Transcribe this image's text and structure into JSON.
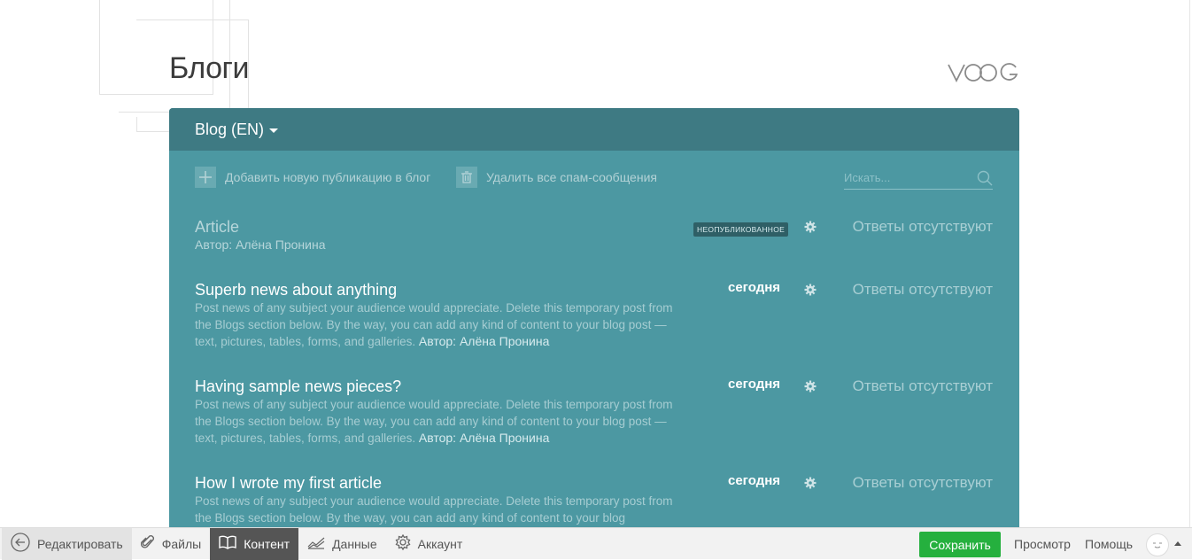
{
  "page": {
    "title": "Блоги",
    "logo_text": "VOOG"
  },
  "panel": {
    "blog_selector": "Blog (EN)",
    "toolbar": {
      "add_post": "Добавить новую публикацию в блог",
      "delete_spam": "Удалить все спам-сообщения",
      "search_placeholder": "Искать..."
    },
    "posts": [
      {
        "title": "Article",
        "author_line": "Автор: Алёна Пронина",
        "badge": "НЕОПУБЛИКОВАННОЕ",
        "replies": "Ответы отсутствуют",
        "published": false
      },
      {
        "title": "Superb news about anything",
        "excerpt": "Post news of any subject your audience would appreciate. Delete this temporary post from the Blogs section below. By the way, you can add any kind of content to your blog post — text, pictures, tables, forms, and galleries.",
        "author": "Автор: Алёна Пронина",
        "date": "сегодня",
        "replies": "Ответы отсутствуют",
        "published": true
      },
      {
        "title": "Having sample news pieces?",
        "excerpt": "Post news of any subject your audience would appreciate. Delete this temporary post from the Blogs section below. By the way, you can add any kind of content to your blog post — text, pictures, tables, forms, and galleries.",
        "author": "Автор: Алёна Пронина",
        "date": "сегодня",
        "replies": "Ответы отсутствуют",
        "published": true
      },
      {
        "title": "How I wrote my first article",
        "excerpt": "Post news of any subject your audience would appreciate. Delete this temporary post from the Blogs section below. By the way, you can add any kind of content to your blog",
        "date": "сегодня",
        "replies": "Ответы отсутствуют",
        "published": true
      }
    ]
  },
  "bottombar": {
    "edit": "Редактировать",
    "files": "Файлы",
    "content": "Контент",
    "data": "Данные",
    "account": "Аккаунт",
    "save": "Сохранить",
    "preview": "Просмотр",
    "help": "Помощь"
  },
  "colors": {
    "panel": "#4c98a2",
    "panel_header": "#3e7a83",
    "save": "#25b03e",
    "active_tab": "#555555"
  }
}
